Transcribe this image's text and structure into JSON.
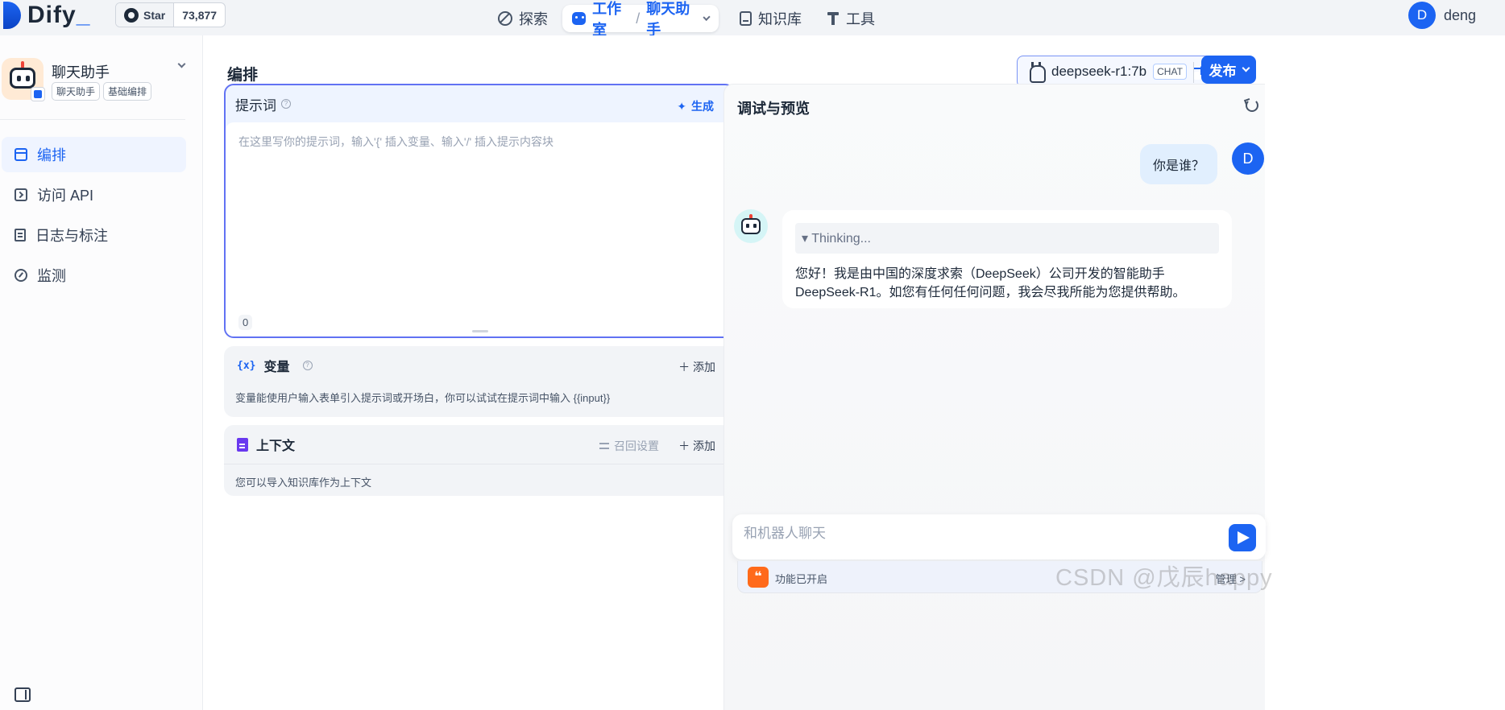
{
  "header": {
    "logo_text": "Dify",
    "logo_dash": "_",
    "github_star_label": "Star",
    "github_star_count": "73,877",
    "nav": {
      "explore": "探索",
      "studio": "工作室",
      "separator": "/",
      "current_app": "聊天助手",
      "knowledge": "知识库",
      "tools": "工具"
    },
    "user_initial": "D",
    "user_name": "deng"
  },
  "sidebar": {
    "app_name": "聊天助手",
    "tags": [
      "聊天助手",
      "基础编排"
    ],
    "items": [
      {
        "label": "编排",
        "active": true,
        "icon": "layout-icon"
      },
      {
        "label": "访问 API",
        "active": false,
        "icon": "terminal-icon"
      },
      {
        "label": "日志与标注",
        "active": false,
        "icon": "file-list-icon"
      },
      {
        "label": "监测",
        "active": false,
        "icon": "gauge-icon"
      }
    ]
  },
  "main": {
    "page_title": "编排",
    "model": {
      "name": "deepseek-r1:7b",
      "mode_tag": "CHAT"
    },
    "publish_label": "发布",
    "prompt": {
      "label": "提示词",
      "generate_label": "生成",
      "placeholder": "在这里写你的提示词，输入'{' 插入变量、输入'/' 插入提示内容块",
      "char_count": "0"
    },
    "variables": {
      "icon_text": "{x}",
      "title": "变量",
      "add_label": "添加",
      "description": "变量能使用户输入表单引入提示词或开场白，你可以试试在提示词中输入 {{input}}"
    },
    "context": {
      "title": "上下文",
      "recall_label": "召回设置",
      "add_label": "添加",
      "description": "您可以导入知识库作为上下文"
    }
  },
  "debug": {
    "title": "调试与预览",
    "user_message": "你是谁？",
    "user_initial": "D",
    "thinking_label": "▾ Thinking...",
    "bot_message": "您好！我是由中国的深度求索（DeepSeek）公司开发的智能助手DeepSeek-R1。如您有任何任何问题，我会尽我所能为您提供帮助。",
    "input_placeholder": "和机器人聊天",
    "feature_icon_text": "❝",
    "feature_text": "功能已开启",
    "feature_manage": "管理 >"
  },
  "watermark": "CSDN @戊辰happy",
  "colors": {
    "accent": "#1c64f2",
    "prompt_border": "#6172f3",
    "feature_orange": "#ff6a1a"
  }
}
